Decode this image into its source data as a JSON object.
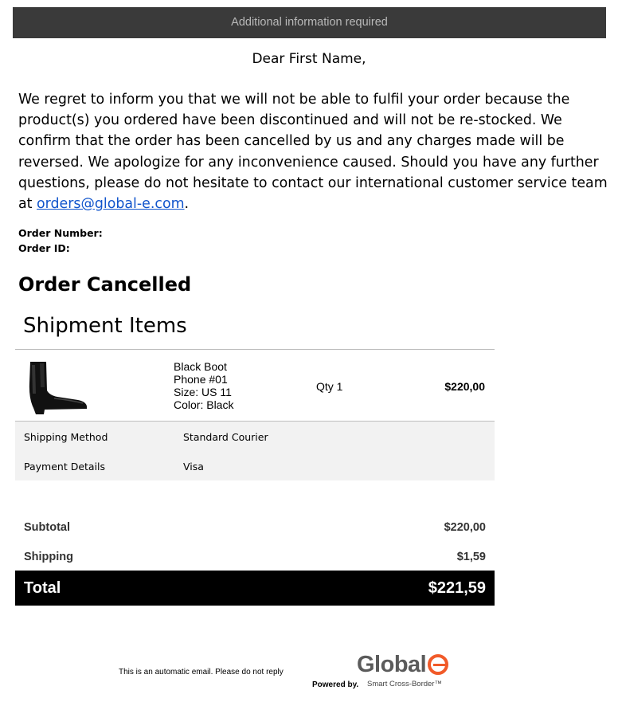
{
  "header": {
    "banner": "Additional information required"
  },
  "email": {
    "greeting": "Dear First Name,",
    "body": "We regret to inform you that we will not be able to fulfil your order because the product(s) you ordered have been discontinued and will not be re-stocked. We confirm that the order has been cancelled by us and any charges made will be reversed. We apologize for any inconvenience caused. Should you have any further questions, please do not hesitate to contact our international customer service team at ",
    "email_link": "orders@global-e.com",
    "body_end": ".",
    "order_number_label": "Order Number:",
    "order_id_label": "Order ID:",
    "status_title": "Order Cancelled"
  },
  "shipment": {
    "title": "Shipment Items",
    "item": {
      "name": "Black Boot",
      "sku": "Phone #01",
      "size": "Size: US 11",
      "color": "Color: Black",
      "qty": "Qty 1",
      "price": "$220,00"
    },
    "shipping_method_label": "Shipping Method",
    "shipping_method_value": "Standard Courier",
    "payment_label": "Payment Details",
    "payment_value": "Visa"
  },
  "summary": {
    "subtotal_label": "Subtotal",
    "subtotal_value": "$220,00",
    "shipping_label": "Shipping",
    "shipping_value": "$1,59",
    "total_label": "Total",
    "total_value": "$221,59"
  },
  "footer": {
    "note": "This is an automatic email. Please do not reply",
    "powered_by": "Powered by.",
    "logo_text": "Global",
    "tagline": "Smart Cross-Border™"
  },
  "colors": {
    "link": "#1155cc",
    "brand_accent": "#f15a29",
    "banner_bg": "#3a3a3a"
  }
}
